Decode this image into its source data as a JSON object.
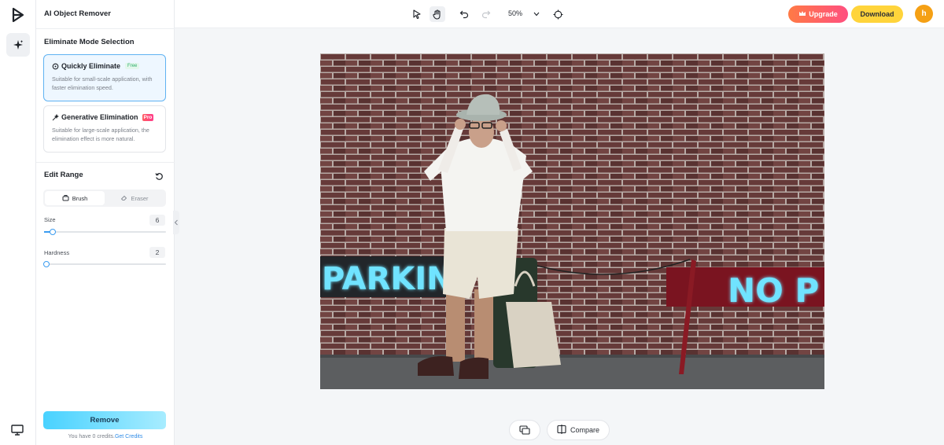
{
  "app": {
    "title": "AI Object Remover"
  },
  "mode": {
    "section_title": "Eliminate Mode Selection",
    "options": [
      {
        "label": "Quickly Eliminate",
        "badge": "Free",
        "description": "Suitable for small-scale application, with faster elimination speed.",
        "selected": true
      },
      {
        "label": "Generative Elimination",
        "badge": "Pro",
        "description": "Suitable for large-scale application, the elimination effect is more natural.",
        "selected": false
      }
    ]
  },
  "edit_range": {
    "title": "Edit Range",
    "tools": [
      {
        "label": "Brush",
        "selected": true
      },
      {
        "label": "Eraser",
        "selected": false
      }
    ],
    "size": {
      "label": "Size",
      "value": "6",
      "level": 0.05
    },
    "hardness": {
      "label": "Hardness",
      "value": "2",
      "level": 0.0
    }
  },
  "actions": {
    "remove_label": "Remove",
    "credits_text": "You have 0 credits.",
    "credits_link": "Get Credits"
  },
  "toolbar": {
    "zoom": "50%",
    "upgrade_label": "Upgrade",
    "download_label": "Download",
    "avatar_initial": "h"
  },
  "bottom": {
    "compare_label": "Compare"
  },
  "image": {
    "signs": [
      "PARKIN",
      "NO P"
    ]
  },
  "colors": {
    "accent": "#3b9cf0",
    "upgrade": "#ff5a6e",
    "download": "#ffd43b",
    "avatar": "#f5a014"
  }
}
